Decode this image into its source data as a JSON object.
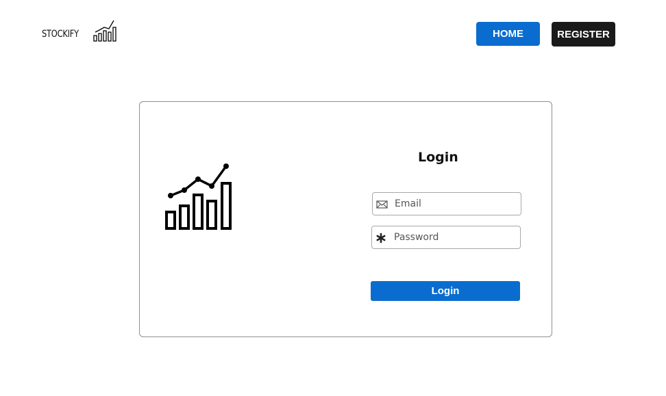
{
  "header": {
    "brand": "STOCKIFY",
    "brand_icon": "stock-chart-icon",
    "nav": {
      "home_label": "HOME",
      "register_label": "REGISTER"
    }
  },
  "login": {
    "illustration_icon": "stock-chart-icon",
    "title": "Login",
    "email_placeholder": "Email",
    "email_icon": "envelope-icon",
    "password_placeholder": "Password",
    "password_icon": "asterisk-icon",
    "submit_label": "Login"
  },
  "colors": {
    "primary": "#0a6ccf",
    "dark": "#1a1a1a",
    "border": "#8f8f8f"
  }
}
